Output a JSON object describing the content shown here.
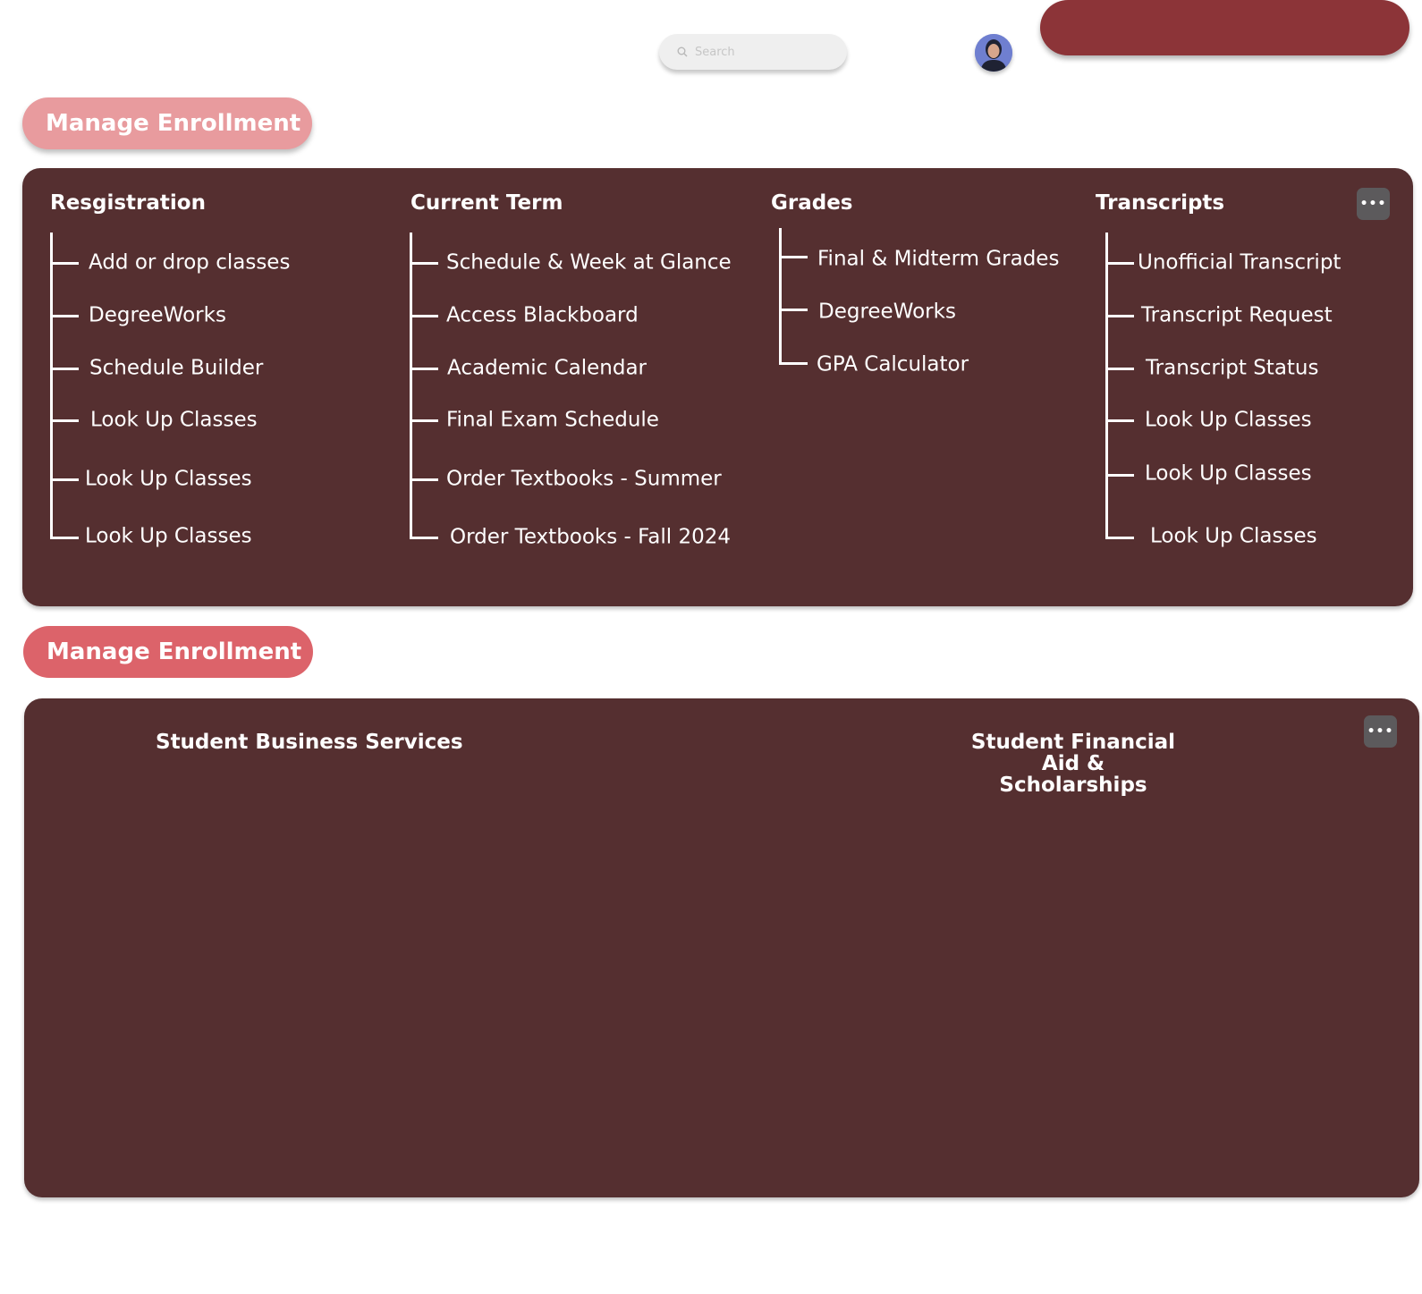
{
  "header": {
    "search_placeholder": "Search",
    "avatar_alt": "User avatar"
  },
  "sections": [
    {
      "title": "Manage Enrollment",
      "columns": [
        {
          "title": "Resgistration",
          "items": [
            "Add or drop classes",
            "DegreeWorks",
            "Schedule Builder",
            "Look Up Classes",
            "Look Up Classes",
            "Look Up Classes"
          ]
        },
        {
          "title": "Current Term",
          "items": [
            "Schedule & Week at Glance",
            "Access Blackboard",
            "Academic Calendar",
            "Final Exam Schedule",
            "Order Textbooks - Summer",
            "Order Textbooks - Fall 2024"
          ]
        },
        {
          "title": "Grades",
          "items": [
            "Final & Midterm Grades",
            "DegreeWorks",
            "GPA Calculator"
          ]
        },
        {
          "title": "Transcripts",
          "items": [
            "Unofficial Transcript",
            "Transcript Request",
            "Transcript Status",
            "Look Up Classes",
            "Look Up Classes",
            "Look Up Classes"
          ]
        }
      ],
      "more_label": "•••"
    },
    {
      "title": "Manage Enrollment",
      "headings": [
        "Student Business Services",
        "Student Financial\nAid & Scholarships"
      ],
      "more_label": "•••"
    }
  ],
  "colors": {
    "panel": "#552f30",
    "pill_light": "#e89b9e",
    "pill_dark": "#dc636a",
    "top_button": "#8c3438"
  }
}
